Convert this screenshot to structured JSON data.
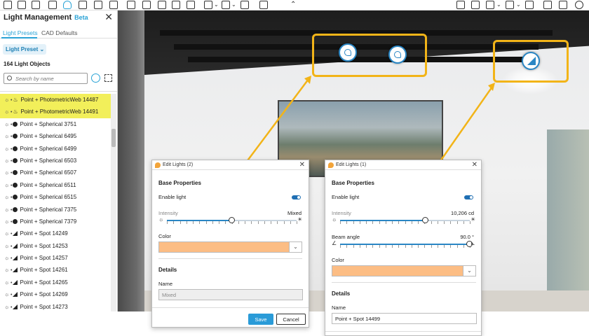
{
  "toolbar": {
    "icons": [
      "floor-plan-icon",
      "document-icon",
      "layers-icon",
      "lightbulb-icon",
      "export-icon",
      "building-icon",
      "globe-icon",
      "cursor-icon",
      "select-icon",
      "refresh-icon",
      "image-icon",
      "camera-icon",
      "video-icon",
      "clip-icon",
      "visibility-icon",
      "lightning-icon",
      "compass-icon",
      "image-right-icon",
      "cube-icon",
      "rotate-icon",
      "gear-small-icon",
      "eye-icon",
      "settings-icon",
      "help-icon"
    ]
  },
  "left_panel": {
    "title": "Light Management",
    "badge": "Beta",
    "tabs": [
      "Light Presets",
      "CAD Defaults"
    ],
    "preset_button": "Light Preset",
    "count_label": "164 Light Objects",
    "search_placeholder": "Search by name",
    "lights": [
      {
        "label": "Point + PhotometricWeb 14487",
        "type": "pw",
        "highlighted": true
      },
      {
        "label": "Point + PhotometricWeb 14491",
        "type": "pw",
        "highlighted": true
      },
      {
        "label": "Point + Spherical 3751",
        "type": "sph",
        "highlighted": false
      },
      {
        "label": "Point + Spherical 6495",
        "type": "sph",
        "highlighted": false
      },
      {
        "label": "Point + Spherical 6499",
        "type": "sph",
        "highlighted": false
      },
      {
        "label": "Point + Spherical 6503",
        "type": "sph",
        "highlighted": false
      },
      {
        "label": "Point + Spherical 6507",
        "type": "sph",
        "highlighted": false
      },
      {
        "label": "Point + Spherical 6511",
        "type": "sph",
        "highlighted": false
      },
      {
        "label": "Point + Spherical 6515",
        "type": "sph",
        "highlighted": false
      },
      {
        "label": "Point + Spherical 7375",
        "type": "sph",
        "highlighted": false
      },
      {
        "label": "Point + Spherical 7379",
        "type": "sph",
        "highlighted": false
      },
      {
        "label": "Point + Spot 14249",
        "type": "spot",
        "highlighted": false
      },
      {
        "label": "Point + Spot 14253",
        "type": "spot",
        "highlighted": false
      },
      {
        "label": "Point + Spot 14257",
        "type": "spot",
        "highlighted": false
      },
      {
        "label": "Point + Spot 14261",
        "type": "spot",
        "highlighted": false
      },
      {
        "label": "Point + Spot 14265",
        "type": "spot",
        "highlighted": false
      },
      {
        "label": "Point + Spot 14269",
        "type": "spot",
        "highlighted": false
      },
      {
        "label": "Point + Spot 14273",
        "type": "spot",
        "highlighted": false
      }
    ]
  },
  "dialog_multi": {
    "title": "Edit Lights (2)",
    "base_properties": "Base Properties",
    "enable_light": "Enable light",
    "enabled": true,
    "intensity_label": "Intensity",
    "intensity_value": "Mixed",
    "intensity_fraction": 0.5,
    "color_label": "Color",
    "color_hex": "#fcbd84",
    "details": "Details",
    "name_label": "Name",
    "name_value": "Mixed",
    "save": "Save",
    "cancel": "Cancel"
  },
  "dialog_single": {
    "title": "Edit Lights (1)",
    "base_properties": "Base Properties",
    "enable_light": "Enable light",
    "enabled": true,
    "intensity_label": "Intensity",
    "intensity_value": "10,206 cd",
    "intensity_fraction": 0.66,
    "beam_label": "Beam angle",
    "beam_value": "90.0 °",
    "beam_fraction": 1.0,
    "color_label": "Color",
    "color_hex": "#fcbd84",
    "details": "Details",
    "name_label": "Name",
    "name_value": "Point + Spot 14499"
  },
  "colors": {
    "accent": "#2a86c4",
    "highlight_row": "#f2ef5a",
    "callout": "#f2b418"
  }
}
